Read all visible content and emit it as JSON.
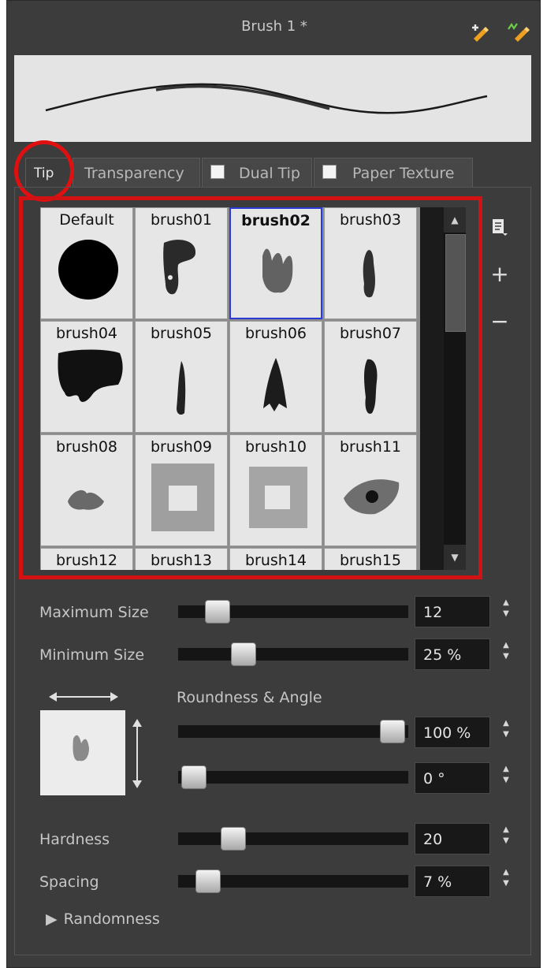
{
  "header": {
    "title": "Brush 1 *",
    "icons": [
      "new-brush-icon",
      "rename-brush-icon"
    ]
  },
  "tabs": [
    {
      "label": "Tip",
      "active": true,
      "checkbox": false
    },
    {
      "label": "Transparency",
      "active": false,
      "checkbox": false
    },
    {
      "label": "Dual Tip",
      "active": false,
      "checkbox": true,
      "checked": false
    },
    {
      "label": "Paper Texture",
      "active": false,
      "checkbox": true,
      "checked": false
    }
  ],
  "brush_tips": {
    "selected": "brush02",
    "items": [
      "Default",
      "brush01",
      "brush02",
      "brush03",
      "brush04",
      "brush05",
      "brush06",
      "brush07",
      "brush08",
      "brush09",
      "brush10",
      "brush11",
      "brush12",
      "brush13",
      "brush14",
      "brush15"
    ]
  },
  "side_buttons": {
    "menu_icon": "menu-icon",
    "add": "+",
    "remove": "−"
  },
  "settings": {
    "maximum_size": {
      "label": "Maximum Size",
      "value": "12",
      "level": 0.12
    },
    "minimum_size": {
      "label": "Minimum Size",
      "value": "25 %",
      "level": 0.25
    },
    "roundness_angle_label": "Roundness & Angle",
    "roundness": {
      "value": "100 %",
      "level": 1.0
    },
    "angle": {
      "value": "0 °",
      "level": 0.0
    },
    "hardness": {
      "label": "Hardness",
      "value": "20",
      "level": 0.2
    },
    "spacing": {
      "label": "Spacing",
      "value": "7 %",
      "level": 0.07
    },
    "randomness_label": "Randomness"
  },
  "colors": {
    "panel": "#3c3c3c",
    "highlight": "#d21212",
    "selection": "#2b3bd6"
  }
}
